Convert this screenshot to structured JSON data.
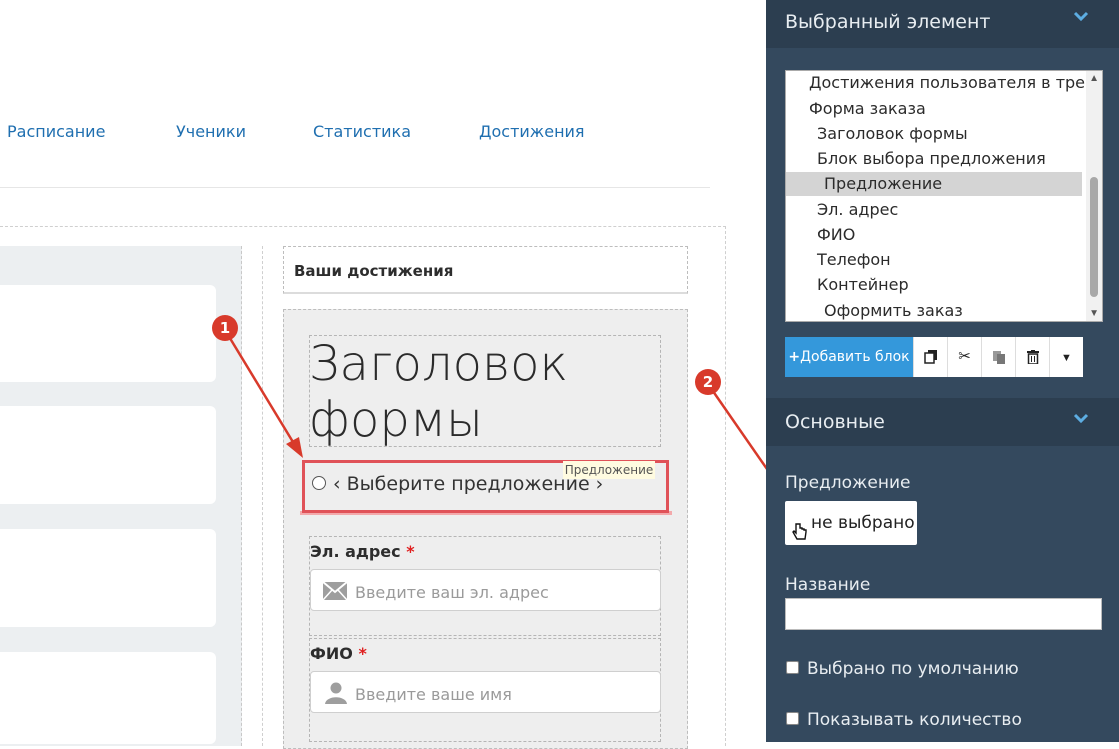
{
  "nav": {
    "items": [
      "Расписание",
      "Ученики",
      "Статистика",
      "Достижения"
    ]
  },
  "canvas": {
    "achievements_title": "Ваши достижения",
    "form_title": "Заголовок формы",
    "offer_tag": "Предложение",
    "offer_text": "‹ Выберите предложение ›",
    "email_label": "Эл. адрес",
    "email_placeholder": "Введите ваш эл. адрес",
    "name_label": "ФИО",
    "name_placeholder": "Введите ваше имя",
    "required_mark": "*"
  },
  "markers": [
    "1",
    "2"
  ],
  "panel": {
    "selected_header": "Выбранный элемент",
    "tree": [
      "Достижения пользователя в тренинге",
      "Форма заказа",
      "Заголовок формы",
      "Блок выбора предложения",
      "Предложение",
      "Эл. адрес",
      "ФИО",
      "Телефон",
      "Контейнер",
      "Оформить заказ"
    ],
    "add_block_label": "Добавить блок",
    "main_header": "Основные",
    "offer_label": "Предложение",
    "offer_value": "не выбрано",
    "title_label": "Название",
    "title_value": "",
    "default_label": "Выбрано по умолчанию",
    "show_qty_label": "Показывать количество"
  },
  "colors": {
    "panel_bg": "#34495e",
    "panel_header": "#2c3e50",
    "accent": "#3498db",
    "annotation_red": "#d83a2b"
  }
}
